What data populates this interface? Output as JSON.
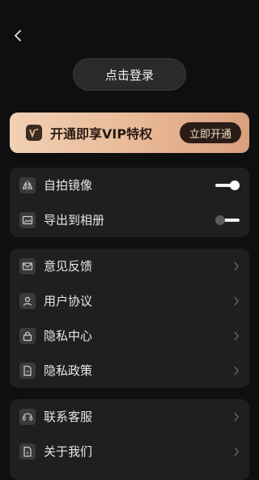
{
  "header": {
    "back_icon": "chevron-left-icon"
  },
  "login": {
    "label": "点击登录"
  },
  "vip": {
    "title": "开通即享VIP特权",
    "button_label": "立即开通",
    "gradient": [
      "#f1d0b4",
      "#d9a07d"
    ]
  },
  "settings_group_1": {
    "items": [
      {
        "label": "自拍镜像",
        "icon": "mirror-icon",
        "toggle": true
      },
      {
        "label": "导出到相册",
        "icon": "image-icon",
        "toggle": false
      }
    ]
  },
  "settings_group_2": {
    "items": [
      {
        "label": "意见反馈",
        "icon": "mail-icon"
      },
      {
        "label": "用户协议",
        "icon": "user-icon"
      },
      {
        "label": "隐私中心",
        "icon": "lock-icon"
      },
      {
        "label": "隐私政策",
        "icon": "document-icon"
      }
    ]
  },
  "settings_group_3": {
    "items": [
      {
        "label": "联系客服",
        "icon": "headset-icon"
      },
      {
        "label": "关于我们",
        "icon": "info-document-icon"
      }
    ]
  }
}
